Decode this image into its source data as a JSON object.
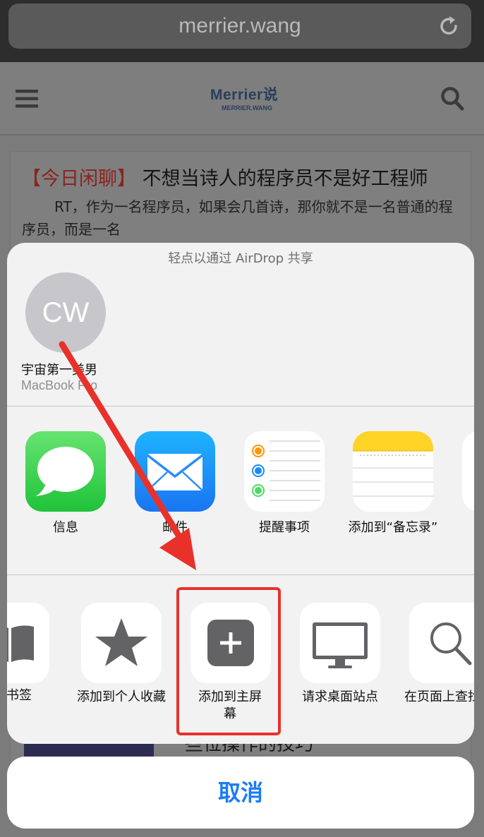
{
  "browser": {
    "url": "merrier.wang"
  },
  "site": {
    "logo_text": "Merrier说",
    "logo_sub": "MERRIER.WANG",
    "article_tag": "【今日闲聊】",
    "article_title": "不想当诗人的程序员不是好工程师",
    "article_excerpt": "RT，作为一名程序员，如果会几首诗，那你就不是一名普通的程序员，而是一名",
    "background_snippet": "一些位操作的技巧"
  },
  "share_sheet": {
    "airdrop_hint": "轻点以通过 AirDrop 共享",
    "airdrop_contact": {
      "initials": "CW",
      "name": "宇宙第一美男",
      "device": "MacBook Pro"
    },
    "apps": [
      {
        "label": "信息",
        "icon": "messages-icon"
      },
      {
        "label": "邮件",
        "icon": "mail-icon"
      },
      {
        "label": "提醒事项",
        "icon": "reminders-icon"
      },
      {
        "label": "添加到“备忘录”",
        "icon": "notes-icon"
      }
    ],
    "actions": [
      {
        "label": "添加书签",
        "icon": "bookmark-icon"
      },
      {
        "label": "添加到个人收藏",
        "icon": "star-icon"
      },
      {
        "label": "添加到主屏幕",
        "icon": "add-square-icon"
      },
      {
        "label": "请求桌面站点",
        "icon": "desktop-icon"
      },
      {
        "label": "在页面上查找",
        "icon": "magnifier-icon"
      }
    ],
    "cancel_label": "取消"
  },
  "colors": {
    "accent": "#1a7cf5",
    "highlight": "#e8312a",
    "messages_green": "#4cd964",
    "mail_blue": "#1d8cf8",
    "notes_yellow": "#ffd426"
  }
}
